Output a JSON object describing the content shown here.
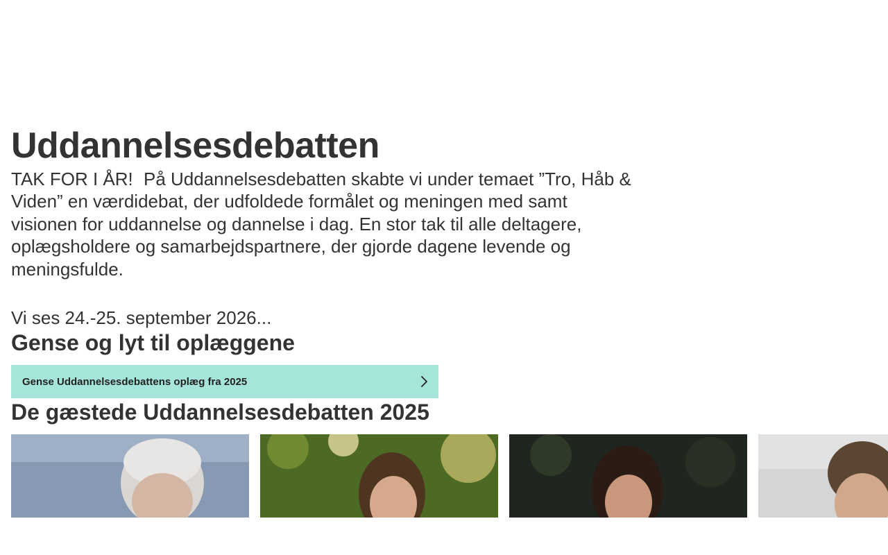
{
  "page": {
    "title": "Uddannelsesdebatten",
    "intro_lead": "TAK FOR I ÅR!",
    "intro_body": "På Uddannelsesdebatten skabte vi under temaet ”Tro, Håb & Viden” en værdidebat, der udfoldede formålet og meningen med samt visionen for uddannelse og dannelse i dag. En stor tak til alle deltagere, oplægsholdere og samarbejdspartnere, der gjorde dagene levende og meningsfulde.",
    "next_date": "Vi ses 24.-25. september 2026..."
  },
  "replay": {
    "title": "Gense og lyt til oplæggene",
    "button_label": "Gense Uddannelsesdebattens oplæg fra 2025",
    "button_icon": "chevron-right-icon",
    "button_color": "#a6e6da"
  },
  "guests": {
    "title": "De gæstede Uddannelsesdebatten 2025",
    "cards": [
      {
        "photo": "guest-photo-1",
        "palette": [
          "#7f93ad",
          "#c9d2de"
        ]
      },
      {
        "photo": "guest-photo-2",
        "palette": [
          "#3e5a1e",
          "#a8b060"
        ]
      },
      {
        "photo": "guest-photo-3",
        "palette": [
          "#1d241c",
          "#3b3f33"
        ]
      },
      {
        "photo": "guest-photo-4",
        "palette": [
          "#cfcfcf",
          "#5d4a3a"
        ]
      }
    ]
  },
  "colors": {
    "text": "#333333",
    "background": "#ffffff",
    "accent": "#a6e6da"
  }
}
